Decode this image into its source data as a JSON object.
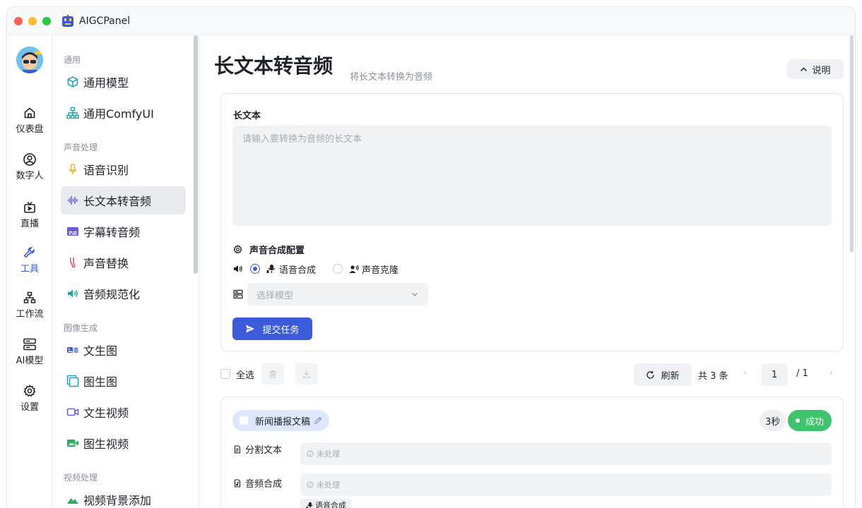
{
  "app": {
    "title": "AIGCPanel"
  },
  "rail": {
    "items": [
      {
        "label": "仪表盘",
        "icon": "home-icon"
      },
      {
        "label": "数字人",
        "icon": "user-circle-icon"
      },
      {
        "label": "直播",
        "icon": "tv-icon"
      },
      {
        "label": "工具",
        "icon": "wrench-icon",
        "active": true
      },
      {
        "label": "工作流",
        "icon": "workflow-icon"
      },
      {
        "label": "AI模型",
        "icon": "server-icon"
      },
      {
        "label": "设置",
        "icon": "gear-icon"
      }
    ]
  },
  "menu": {
    "groups": [
      {
        "title": "通用",
        "items": [
          {
            "label": "通用模型",
            "icon": "cube-icon"
          },
          {
            "label": "通用ComfyUI",
            "icon": "hierarchy-icon"
          }
        ]
      },
      {
        "title": "声音处理",
        "items": [
          {
            "label": "语音识别",
            "icon": "microphone-icon"
          },
          {
            "label": "长文本转音频",
            "icon": "waveform-icon",
            "active": true
          },
          {
            "label": "字幕转音频",
            "icon": "subtitle-icon"
          },
          {
            "label": "声音替换",
            "icon": "voice-replace-icon"
          },
          {
            "label": "音频规范化",
            "icon": "speaker-icon"
          }
        ]
      },
      {
        "title": "图像生成",
        "items": [
          {
            "label": "文生图",
            "icon": "text-image-icon"
          },
          {
            "label": "图生图",
            "icon": "image-layers-icon"
          },
          {
            "label": "文生视频",
            "icon": "video-camera-icon"
          },
          {
            "label": "图生视频",
            "icon": "image-video-icon"
          }
        ]
      },
      {
        "title": "视频处理",
        "items": [
          {
            "label": "视频背景添加",
            "icon": "mountain-icon"
          }
        ]
      }
    ]
  },
  "page": {
    "title": "长文本转音频",
    "subtitle": "将长文本转换为音频",
    "explain_label": "说明"
  },
  "form": {
    "text_label": "长文本",
    "text_placeholder": "请输入要转换为音频的长文本",
    "text_value": "",
    "config_title": "声音合成配置",
    "radio_options": [
      {
        "label": "语音合成",
        "checked": true
      },
      {
        "label": "声音克隆",
        "checked": false
      }
    ],
    "model_placeholder": "选择模型",
    "submit_label": "提交任务"
  },
  "list": {
    "select_all_label": "全选",
    "refresh_label": "刷新",
    "total_text": "共 3 条",
    "page_current": "1",
    "page_total_text": "/ 1",
    "prev_arrow": "‹",
    "next_arrow": "›"
  },
  "task": {
    "name": "新闻播报文稿",
    "duration": "3秒",
    "status": "成功",
    "steps": [
      {
        "label": "分割文本",
        "value": "未处理"
      },
      {
        "label": "音频合成",
        "value": "未处理"
      }
    ],
    "sub_tag": "语音合成"
  },
  "colors": {
    "primary": "#3b5bdb",
    "success": "#3ec46d",
    "active_bg": "#e9eaee"
  }
}
